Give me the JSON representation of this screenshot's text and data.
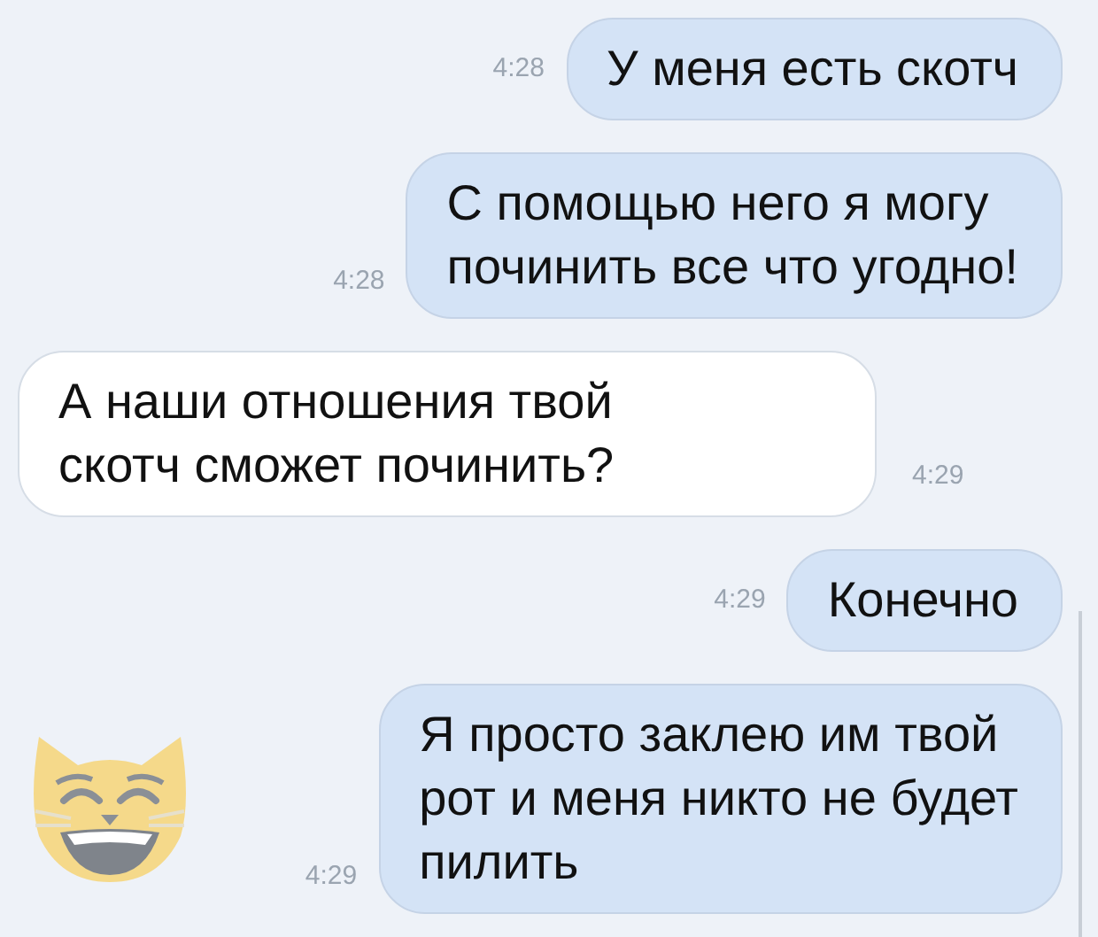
{
  "messages": [
    {
      "kind": "outgoing",
      "text": "У меня есть скотч",
      "time": "4:28",
      "has_emoji": false
    },
    {
      "kind": "outgoing",
      "text": "С помощью него я могу\nпочинить все что угодно!",
      "time": "4:28",
      "has_emoji": false
    },
    {
      "kind": "incoming",
      "text": "А наши отношения твой\nскотч сможет починить?",
      "time": "4:29",
      "has_emoji": false
    },
    {
      "kind": "outgoing",
      "text": "Конечно",
      "time": "4:29",
      "has_emoji": false
    },
    {
      "kind": "outgoing",
      "text": "Я просто заклею им твой\nрот и меня никто не будет\nпилить",
      "time": "4:29",
      "has_emoji": true
    }
  ]
}
